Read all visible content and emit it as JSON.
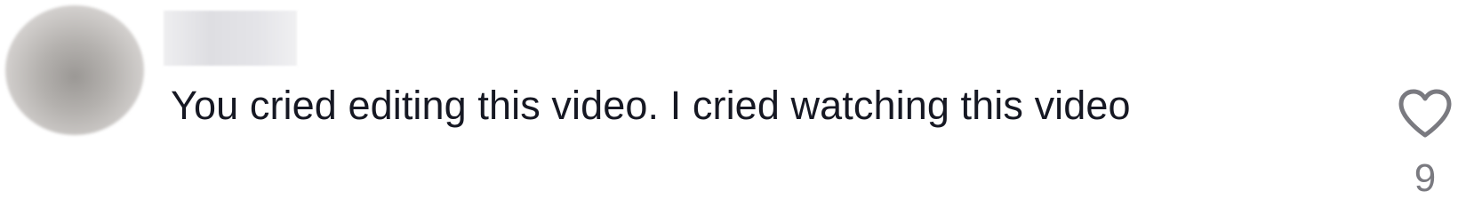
{
  "comment": {
    "text": "You cried editing this video. I cried watching this video",
    "like_count": "9"
  },
  "icons": {
    "like": "heart-outline-icon"
  },
  "colors": {
    "text": "#161823",
    "icon": "#7a7a80",
    "background": "#ffffff"
  }
}
